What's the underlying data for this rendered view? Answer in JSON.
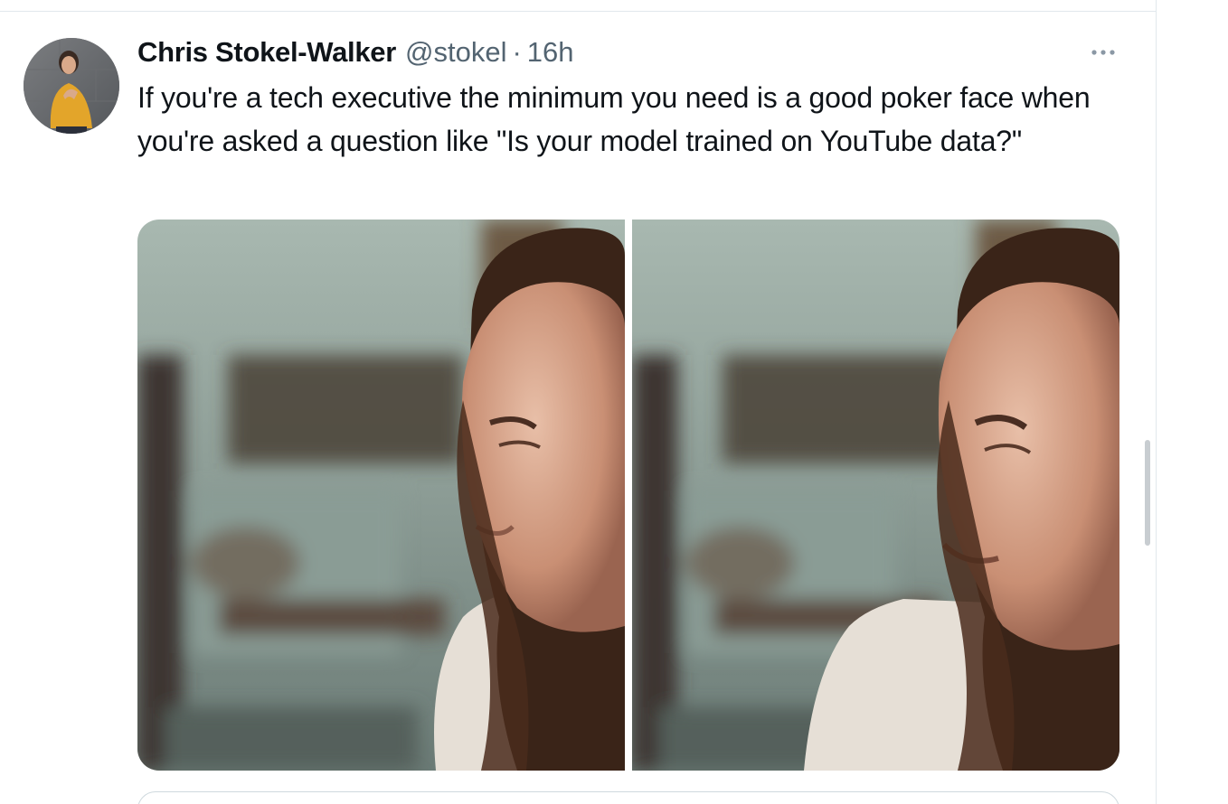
{
  "tweet": {
    "author_name": "Chris Stokel-Walker",
    "handle": "@stokel",
    "separator": "·",
    "time": "16h",
    "text": "If you're a tech executive the minimum you need is a good poker face when you're asked a question like \"Is your model trained on YouTube data?\"",
    "more_icon": "more-horizontal-icon"
  },
  "media": {
    "count": 2,
    "photos": [
      {
        "subject": "neutral-expression-photo"
      },
      {
        "subject": "grimace-expression-photo"
      }
    ]
  },
  "colors": {
    "text_primary": "#0f1419",
    "text_secondary": "#536471",
    "divider": "#e1e8ed"
  }
}
